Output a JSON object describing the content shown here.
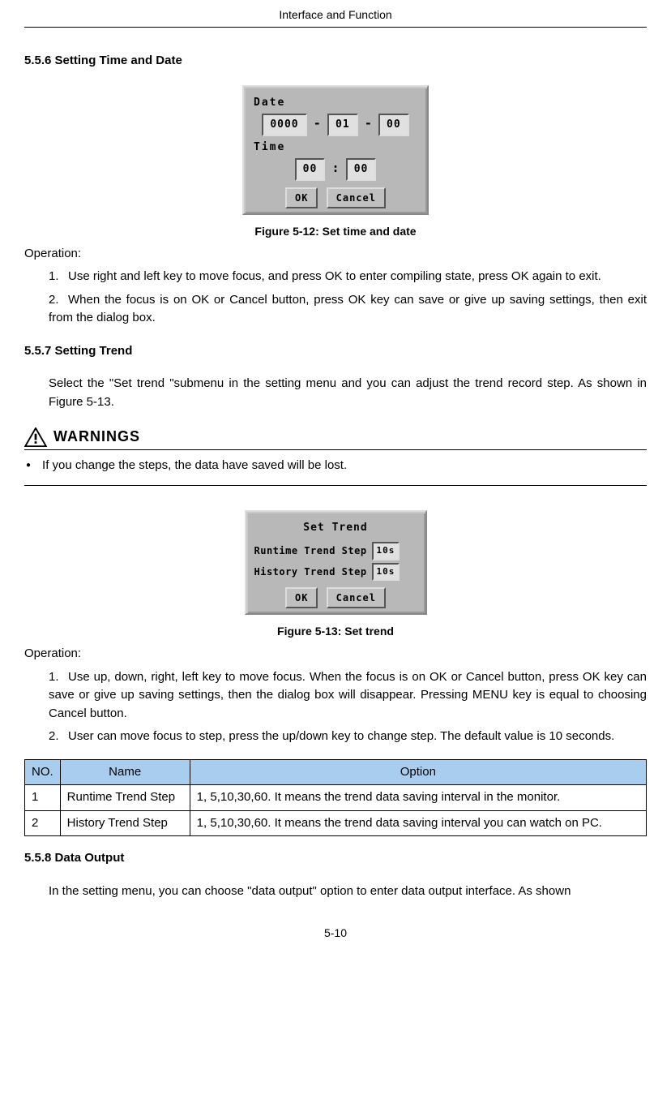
{
  "header": {
    "title": "Interface and Function"
  },
  "section_556": {
    "heading": "5.5.6 Setting Time and Date",
    "dialog": {
      "date_label": "Date",
      "year": "0000",
      "month": "01",
      "day": "00",
      "time_label": "Time",
      "hour": "00",
      "minute": "00",
      "ok": "OK",
      "cancel": "Cancel"
    },
    "caption": "Figure 5-12: Set time and date",
    "operation_label": "Operation:",
    "steps": [
      {
        "num": "1.",
        "text": "Use right and left key to move focus, and press OK to enter compiling state, press OK again to exit."
      },
      {
        "num": "2.",
        "text": "When the focus is on OK or Cancel button, press OK key can save or give up saving settings, then exit from the dialog box."
      }
    ]
  },
  "section_557": {
    "heading": "5.5.7 Setting Trend",
    "intro": "Select the \"Set trend \"submenu in the setting menu and you can adjust the trend record step. As shown in Figure 5-13.",
    "warnings_title": "WARNINGS",
    "warning_bullet": "If you change the steps, the data have saved will be lost.",
    "dialog": {
      "title": "Set Trend",
      "runtime_label": "Runtime Trend Step",
      "runtime_value": "10s",
      "history_label": "History Trend Step",
      "history_value": "10s",
      "ok": "OK",
      "cancel": "Cancel"
    },
    "caption": "Figure 5-13: Set trend",
    "operation_label": "Operation:",
    "steps": [
      {
        "num": "1.",
        "text": "Use up, down, right, left key to move focus. When the focus is on OK or Cancel button, press OK key can save or give up saving settings, then the dialog box will disappear. Pressing MENU key is equal to choosing Cancel button."
      },
      {
        "num": "2.",
        "text": "User can move focus to step, press the up/down key to change step. The default value is 10 seconds."
      }
    ],
    "table": {
      "headers": {
        "no": "NO.",
        "name": "Name",
        "option": "Option"
      },
      "rows": [
        {
          "no": "1",
          "name": "Runtime Trend Step",
          "option": "1, 5,10,30,60. It means the trend data saving interval in the monitor."
        },
        {
          "no": "2",
          "name": "History Trend Step",
          "option": "1, 5,10,30,60. It means the trend data saving interval you can watch on PC."
        }
      ]
    }
  },
  "section_558": {
    "heading": "5.5.8 Data Output",
    "intro": "In the setting menu, you can choose \"data output\" option to enter data output interface. As shown"
  },
  "footer": {
    "page": "5-10"
  }
}
